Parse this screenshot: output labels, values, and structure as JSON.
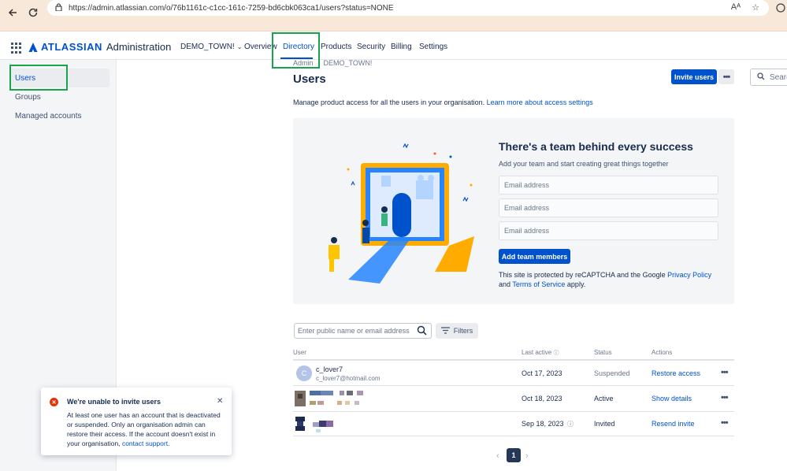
{
  "browser": {
    "url": "https://admin.atlassian.com/o/76b1161c-c1cc-161c-7259-bd6cbk063ca1/users?status=NONE",
    "reader_icon": "Aᴬ"
  },
  "header": {
    "brand": "ATLASSIAN",
    "product": "Administration",
    "org": "DEMO_TOWN!",
    "nav": [
      "Overview",
      "Directory",
      "Products",
      "Security",
      "Billing",
      "Settings"
    ],
    "active_nav": "Directory",
    "search_placeholder": "Search"
  },
  "sidebar": {
    "items": [
      {
        "label": "Users",
        "active": true
      },
      {
        "label": "Groups",
        "active": false
      },
      {
        "label": "Managed accounts",
        "active": false
      }
    ]
  },
  "main": {
    "breadcrumb": [
      "Admin",
      "DEMO_TOWN!"
    ],
    "title": "Users",
    "invite_button": "Invite users",
    "description": "Manage product access for all the users in your organisation.",
    "description_link": "Learn more about access settings"
  },
  "promo": {
    "title": "There's a team behind every success",
    "subtitle": "Add your team and start creating great things together",
    "email_placeholder": "Email address",
    "add_button": "Add team members",
    "recaptcha_prefix": "This site is protected by reCAPTCHA and the Google",
    "privacy_link": "Privacy Policy",
    "and": "and",
    "terms_link": "Terms of Service",
    "apply": "apply."
  },
  "filters": {
    "search_placeholder": "Enter public name or email address",
    "filters_label": "Filters"
  },
  "table": {
    "headers": {
      "user": "User",
      "last_active": "Last active",
      "status": "Status",
      "actions": "Actions"
    },
    "rows": [
      {
        "avatar": "C",
        "name": "c_lover7",
        "email": "c_lover7@hotmail.com",
        "last_active": "Oct 17, 2023",
        "status": "Suspended",
        "action": "Restore access"
      },
      {
        "avatar": "",
        "name": "",
        "email": "",
        "last_active": "Oct 18, 2023",
        "status": "Active",
        "action": "Show details"
      },
      {
        "avatar": "",
        "name": "",
        "email": "",
        "last_active": "Sep 18, 2023",
        "status": "Invited",
        "action": "Resend invite"
      }
    ]
  },
  "pagination": {
    "current": "1"
  },
  "toast": {
    "title": "We're unable to invite users",
    "body": "At least one user has an account that is deactivated or suspended. Only an organisation admin can restore their access. If the account doesn't exist in your organisation,",
    "link": "contact support",
    "end": "."
  },
  "colors": {
    "brand": "#0052cc",
    "highlight_box": "#1aa34a",
    "error": "#de350b",
    "browser_bar": "#f7e8da"
  }
}
